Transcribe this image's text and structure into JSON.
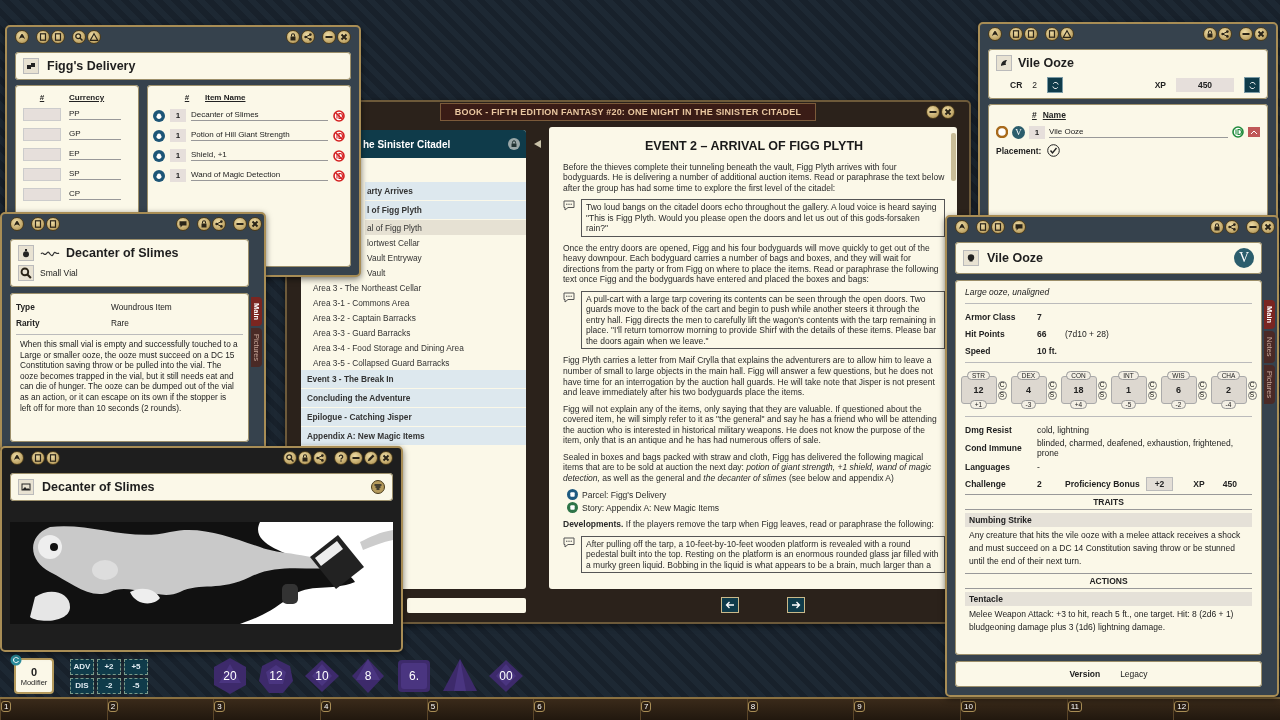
{
  "book": {
    "tab_title": "BOOK - FIFTH EDITION FANTASY #20: ONE NIGHT IN THE SINISTER CITADEL",
    "toc": {
      "header": "he Sinister Citadel",
      "cut_rows": [
        {
          "kind": "chapter",
          "text": "arty Arrives",
          "selected": false
        },
        {
          "kind": "chapter",
          "text": "l of Figg Plyth",
          "selected": false
        },
        {
          "kind": "section",
          "text": "al of Figg Plyth",
          "selected": true
        },
        {
          "kind": "section",
          "text": "lortwest Cellar",
          "selected": false
        },
        {
          "kind": "section",
          "text": "Vault Entryway",
          "selected": false
        },
        {
          "kind": "section",
          "text": "Vault",
          "selected": false
        }
      ],
      "rows": [
        {
          "kind": "section",
          "text": "Area 3 - The Northeast Cellar",
          "selected": false
        },
        {
          "kind": "section",
          "text": "Area 3-1 - Commons Area",
          "selected": false
        },
        {
          "kind": "section",
          "text": "Area 3-2 - Captain Barracks",
          "selected": false
        },
        {
          "kind": "section",
          "text": "Area 3-3 - Guard Barracks",
          "selected": false
        },
        {
          "kind": "section",
          "text": "Area 3-4 - Food Storage and Dining Area",
          "selected": false
        },
        {
          "kind": "section",
          "text": "Area 3-5 - Collapsed Guard Barracks",
          "selected": false
        },
        {
          "kind": "chapter",
          "text": "Event 3 - The Break In",
          "selected": false
        },
        {
          "kind": "chapter",
          "text": "Concluding the Adventure",
          "selected": false
        },
        {
          "kind": "chapter",
          "text": "Epilogue - Catching Jisper",
          "selected": false
        },
        {
          "kind": "chapter",
          "text": "Appendix A: New Magic Items",
          "selected": false
        }
      ]
    },
    "page": [
      {
        "kind": "heading",
        "text": "EVENT 2 – ARRIVAL OF FIGG PLYTH"
      },
      {
        "kind": "para",
        "text": "Before the thieves complete their tunneling beneath the vault, Figg Plyth arrives with four bodyguards. He is delivering a number of additional auction items. Read or paraphrase the text below after the group has had some time to explore the first level of the citadel:"
      },
      {
        "kind": "quote",
        "text": "Two loud bangs on the citadel doors echo throughout the gallery. A loud voice is heard saying \"This is Figg Plyth. Would you please open the doors and let us out of this gods-forsaken rain?\""
      },
      {
        "kind": "para",
        "text": "Once the entry doors are opened, Figg and his four bodyguards will move quickly to get out of the heavy downpour. Each bodyguard carries a number of bags and boxes, and they will wait for directions from the party or from Figg on where to place the items. Read or paraphrase the following text once Figg and the bodyguards have entered and placed the boxes and bags:"
      },
      {
        "kind": "quote",
        "text": "A pull-cart with a large tarp covering its contents can be seen through the open doors. Two guards move to the back of the cart and begin to push while another steers it through the entry hall. Figg directs the men to carefully lift the wagon's contents with the tarp remaining in place. \"I'll return tomorrow morning to provide Shirf with the details of these items. Please bar the doors again when we leave.\""
      },
      {
        "kind": "para",
        "text": "Figg Plyth carries a letter from Maif Crylla that explains the adventurers are to allow him to leave a number of small to large objects in the main hall. Figg will answer a few questions, but he does not have time for an interrogation by the auction hall guards. He will take note that Jisper is not present and leave immediately after his two bodyguards place the items."
      },
      {
        "kind": "para",
        "text": "Figg will not explain any of the items, only saying that they are valuable. If questioned about the covered item, he will simply refer to it as \"the general\" and say he has a friend who will be attending the auction who is interested in historical military weapons. He does not know the purpose of the item, only that is an antique and he has had numerous offers of sale."
      },
      {
        "kind": "para",
        "text": "Sealed in boxes and bags packed with straw and cloth, Figg has delivered the following magical items that are to be sold at auction the next day: *potion of giant strength, +1 shield, wand of magic detection,* as well as the general and *the decanter of slimes* (see below and appendix A)"
      },
      {
        "kind": "link",
        "text": "Parcel: Figg's Delivery",
        "color": "#1e5a80"
      },
      {
        "kind": "link",
        "text": "Story: Appendix A: New Magic Items",
        "color": "#2e7448"
      },
      {
        "kind": "para",
        "text": "**Developments.** If the players remove the tarp when Figg leaves, read or paraphrase the following:"
      },
      {
        "kind": "quote",
        "text": "After pulling off the tarp, a 10-feet-by-10-feet wooden platform is revealed with a round pedestal built into the top. Resting on the platform is an enormous rounded glass jar filled with a murky green liquid. Bobbing in the liquid is what appears to be a brain, much larger than a"
      }
    ]
  },
  "parcel": {
    "title": "Figg's Delivery",
    "currency": {
      "columns": [
        "#",
        "Currency"
      ],
      "rows": [
        "PP",
        "GP",
        "EP",
        "SP",
        "CP"
      ]
    },
    "items": {
      "columns": [
        "#",
        "Item Name"
      ],
      "rows": [
        {
          "qty": "1",
          "name": "Decanter of Slimes"
        },
        {
          "qty": "1",
          "name": "Potion of Hill Giant Strength"
        },
        {
          "qty": "1",
          "name": "Shield, +1"
        },
        {
          "qty": "1",
          "name": "Wand of Magic Detection"
        }
      ]
    }
  },
  "item": {
    "title": "Decanter of Slimes",
    "subtitle": "Small Vial",
    "fields": [
      {
        "label": "Type",
        "value": "Woundrous Item"
      },
      {
        "label": "Rarity",
        "value": "Rare"
      }
    ],
    "description": "When this small vial is empty and successfully touched to a Large or smaller ooze, the ooze must succeed on a DC 15 Constitution saving throw or be pulled into the vial. The ooze becomes trapped in the vial, but it still needs eat and can die of hunger. The ooze can be dumped out of the vial as an action, or it can escape on its own if the stopper is left off for more than 10 seconds (2 rounds).",
    "tabs": [
      {
        "label": "Main",
        "selected": true
      },
      {
        "label": "Pictures",
        "selected": false
      }
    ]
  },
  "image_window": {
    "title": "Decanter of Slimes"
  },
  "encounter": {
    "title": "Vile Ooze",
    "cr_label": "CR",
    "cr": "2",
    "xp_label": "XP",
    "xp": "450",
    "columns": [
      "#",
      "Name"
    ],
    "rows": [
      {
        "badge": "V",
        "qty": "1",
        "name": "Vile Ooze"
      }
    ],
    "placement": {
      "label": "Placement:",
      "checked": true
    }
  },
  "npc": {
    "title": "Vile Ooze",
    "badge": "V",
    "type_line": "Large ooze, unaligned",
    "stats": [
      {
        "label": "Armor Class",
        "value": "7"
      },
      {
        "label": "Hit Points",
        "value": "66",
        "extra": "(7d10 + 28)"
      },
      {
        "label": "Speed",
        "value": "10 ft."
      }
    ],
    "abilities": [
      {
        "label": "STR",
        "score": "12",
        "mod": "+1",
        "marks": [
          "C",
          "S"
        ]
      },
      {
        "label": "DEX",
        "score": "4",
        "mod": "-3",
        "marks": [
          "C",
          "S"
        ]
      },
      {
        "label": "CON",
        "score": "18",
        "mod": "+4",
        "marks": [
          "C",
          "S"
        ]
      },
      {
        "label": "INT",
        "score": "1",
        "mod": "-5",
        "marks": [
          "C",
          "S"
        ]
      },
      {
        "label": "WIS",
        "score": "6",
        "mod": "-2",
        "marks": [
          "C",
          "S"
        ]
      },
      {
        "label": "CHA",
        "score": "2",
        "mod": "-4",
        "marks": [
          "C",
          "S"
        ]
      }
    ],
    "details": [
      {
        "label": "Dmg Resist",
        "value": "cold, lightning"
      },
      {
        "label": "Cond Immune",
        "value": "blinded, charmed, deafened, exhaustion, frightened, prone"
      },
      {
        "label": "Languages",
        "value": "-"
      }
    ],
    "challenge": {
      "label": "Challenge",
      "value": "2",
      "prof_label": "Proficiency Bonus",
      "prof": "+2",
      "xp_label": "XP",
      "xp": "450"
    },
    "sections": [
      {
        "title": "TRAITS",
        "entries": [
          {
            "name": "Numbing Strike",
            "text": "Any creature that hits the vile ooze with a melee attack receives a shock and must succeed on a DC 14 Constitution saving throw or be stunned until the end of their next turn."
          }
        ]
      },
      {
        "title": "ACTIONS",
        "entries": [
          {
            "name": "Tentacle",
            "text": "Melee Weapon Attack: +3 to hit, reach 5 ft., one target. Hit: 8 (2d6 + 1) bludgeoning damage plus 3 (1d6) lightning damage."
          }
        ]
      }
    ],
    "version": {
      "label": "Version",
      "value": "Legacy"
    },
    "tabs": [
      {
        "label": "Main",
        "selected": true
      },
      {
        "label": "Notes",
        "selected": false
      },
      {
        "label": "Pictures",
        "selected": false
      }
    ]
  },
  "dice_tray": {
    "modifier": {
      "value": "0",
      "label": "Modifier"
    },
    "buttons": [
      "ADV",
      "+2",
      "+5",
      "DIS",
      "-2",
      "-5"
    ],
    "dice": [
      {
        "kind": "d20",
        "label": "20"
      },
      {
        "kind": "d12",
        "label": "12"
      },
      {
        "kind": "d10",
        "label": "10"
      },
      {
        "kind": "d8",
        "label": "8"
      },
      {
        "kind": "d6",
        "label": "6."
      },
      {
        "kind": "d4"
      },
      {
        "kind": "d100",
        "label": "00"
      }
    ]
  },
  "hotbar": {
    "slots": [
      "1",
      "2",
      "3",
      "4",
      "5",
      "6",
      "7",
      "8",
      "9",
      "10",
      "11",
      "12"
    ]
  }
}
